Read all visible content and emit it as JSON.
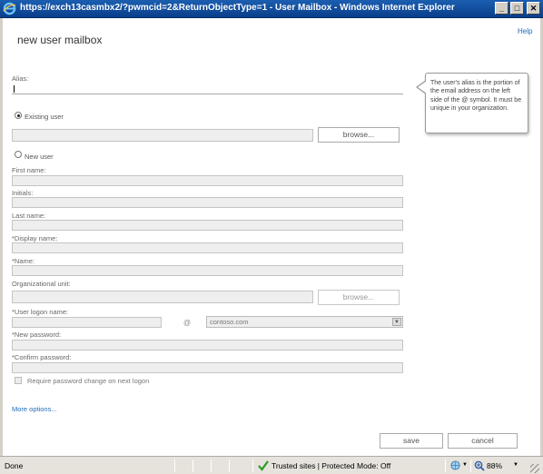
{
  "window": {
    "title": "https://exch13casmbx2/?pwmcid=2&ReturnObjectType=1 - User Mailbox - Windows Internet Explorer",
    "minimize_glyph": "_",
    "maximize_glyph": "□",
    "close_glyph": "✕"
  },
  "page": {
    "help_label": "Help",
    "title": "new user mailbox"
  },
  "form": {
    "alias_label": "Alias:",
    "alias_value": "",
    "existing_user_label": "Existing user",
    "existing_user_browse_label": "browse...",
    "new_user_label": "New user",
    "first_name_label": "First name:",
    "initials_label": "Initials:",
    "last_name_label": "Last name:",
    "display_name_label": "*Display name:",
    "name_label": "*Name:",
    "ou_label": "Organizational unit:",
    "ou_browse_label": "browse...",
    "logon_name_label": "*User logon name:",
    "at_sign": "@",
    "domain_value": "contoso.com",
    "new_password_label": "*New password:",
    "confirm_password_label": "*Confirm password:",
    "require_change_label": "Require password change on next logon",
    "more_options_label": "More options...",
    "selected_user_type": "existing"
  },
  "tooltip": {
    "text": "The user's alias is the portion of the email address on the left side of the @ symbol. It must be unique in your organization."
  },
  "actions": {
    "save_label": "save",
    "cancel_label": "cancel"
  },
  "statusbar": {
    "status_text": "Done",
    "zone_text": "Trusted sites | Protected Mode: Off",
    "zoom_text": "88%"
  },
  "colors": {
    "titlebar": "#0a3f8c",
    "link": "#1e6bb8",
    "check_icon": "#2a9a2a"
  },
  "icons": [
    "ie-logo-icon",
    "check-icon",
    "globe-icon",
    "zoom-icon",
    "dropdown-arrow-icon"
  ]
}
